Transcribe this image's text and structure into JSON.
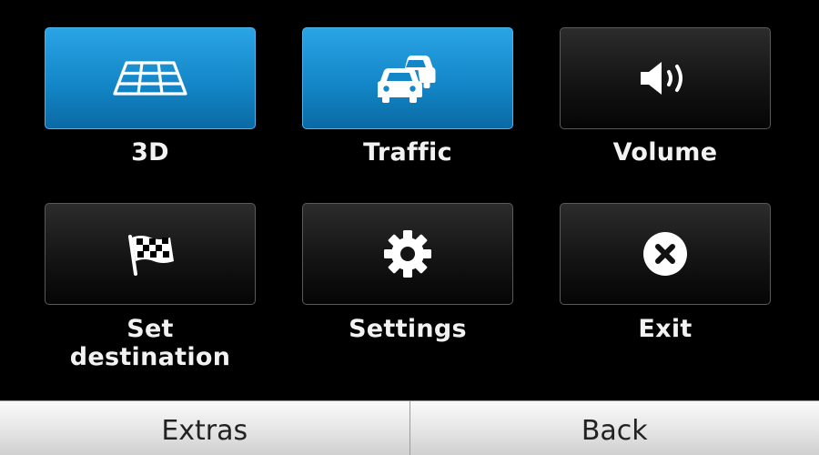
{
  "menu": {
    "items": [
      {
        "label": "3D",
        "icon": "3d-grid-icon",
        "active": true
      },
      {
        "label": "Traffic",
        "icon": "traffic-cars-icon",
        "active": true
      },
      {
        "label": "Volume",
        "icon": "speaker-icon",
        "active": false
      },
      {
        "label": "Set destination",
        "icon": "checkered-flag-icon",
        "active": false
      },
      {
        "label": "Settings",
        "icon": "gear-icon",
        "active": false
      },
      {
        "label": "Exit",
        "icon": "close-circle-icon",
        "active": false
      }
    ]
  },
  "softkeys": {
    "left_label": "Extras",
    "right_label": "Back"
  },
  "colors": {
    "active_tile": "#1487c8",
    "inactive_tile": "#141414",
    "bar": "#e6e6e6"
  }
}
